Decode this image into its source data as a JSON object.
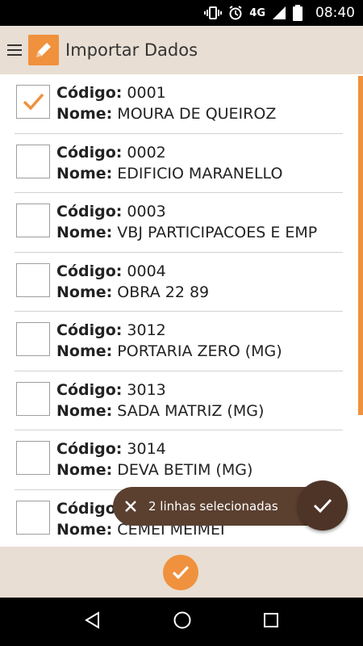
{
  "status_bar": {
    "network": "4G",
    "time": "08:40"
  },
  "app_bar": {
    "title": "Importar Dados"
  },
  "list": {
    "codigo_label": "Código:",
    "nome_label": "Nome:",
    "items": [
      {
        "codigo": "0001",
        "nome": "MOURA DE QUEIROZ",
        "checked": true
      },
      {
        "codigo": "0002",
        "nome": "EDIFICIO MARANELLO",
        "checked": false
      },
      {
        "codigo": "0003",
        "nome": "VBJ PARTICIPACOES E EMP",
        "checked": false
      },
      {
        "codigo": "0004",
        "nome": "OBRA 22 89",
        "checked": false
      },
      {
        "codigo": "3012",
        "nome": "PORTARIA ZERO (MG)",
        "checked": false
      },
      {
        "codigo": "3013",
        "nome": "SADA MATRIZ (MG)",
        "checked": false
      },
      {
        "codigo": "3014",
        "nome": "DEVA BETIM (MG)",
        "checked": false
      },
      {
        "codigo": "",
        "nome": "CEMEI MEIMEI",
        "checked": false
      }
    ]
  },
  "snackbar": {
    "message": "2 linhas selecionadas"
  },
  "colors": {
    "accent": "#f0913d",
    "bar": "#e8ded3",
    "snackbar": "#5b4030"
  }
}
